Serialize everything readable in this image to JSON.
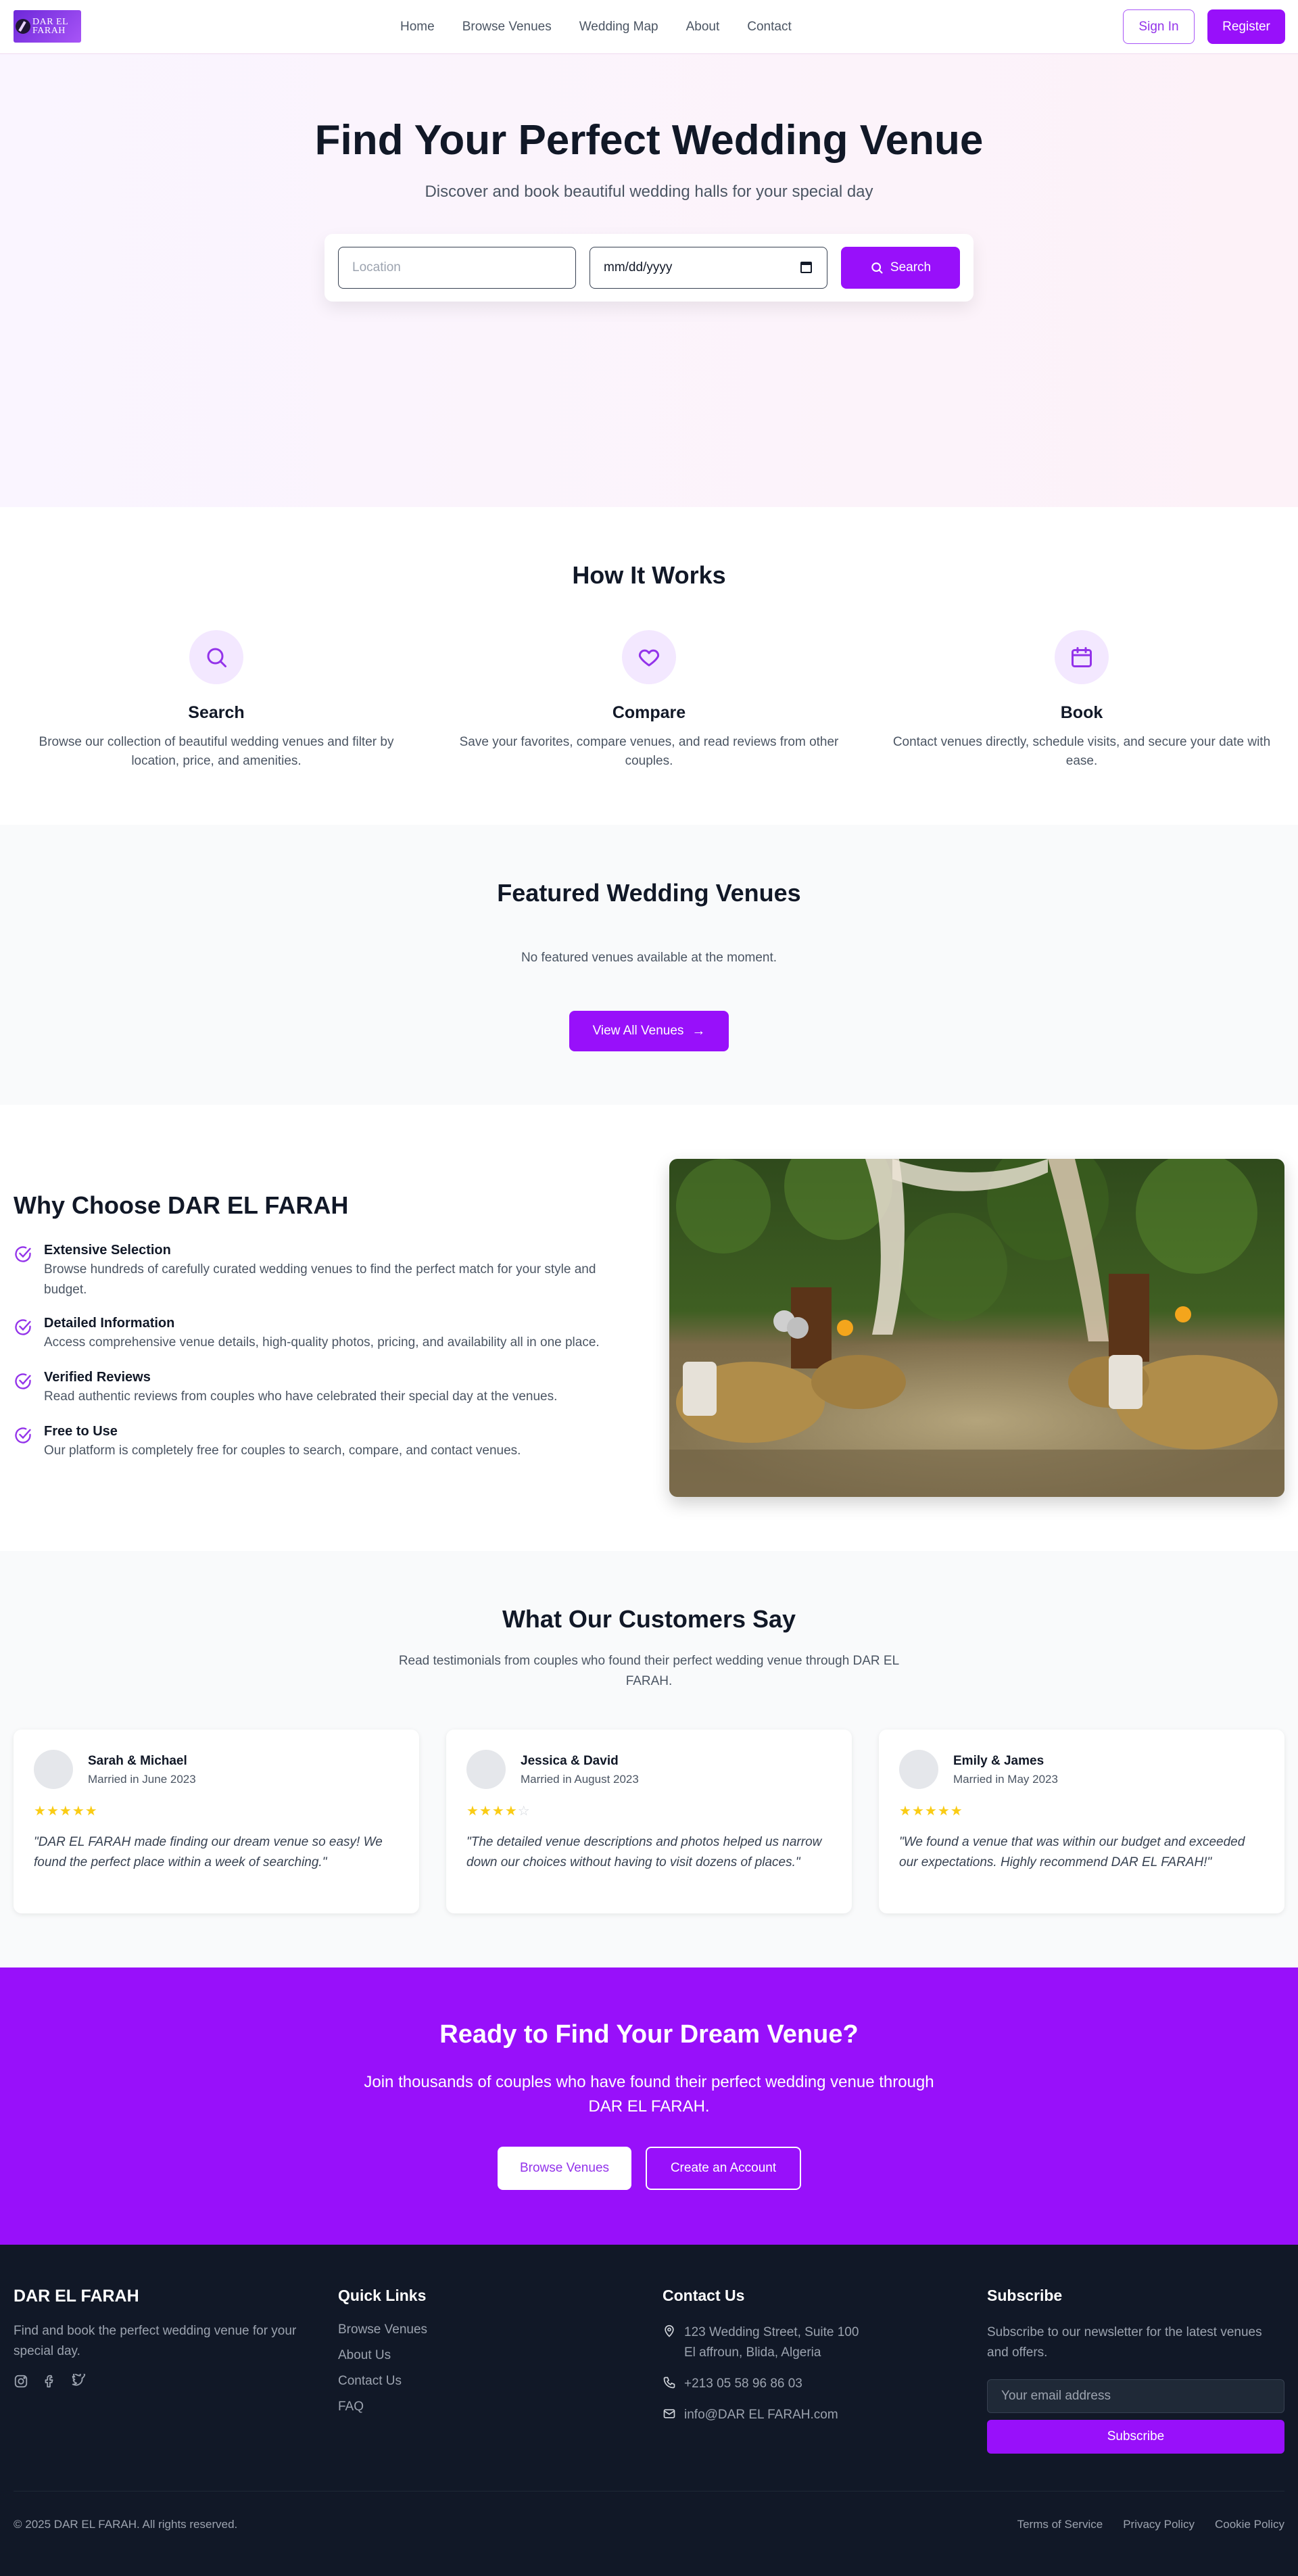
{
  "header": {
    "logo_text_line1": "DAR EL",
    "logo_text_line2": "FARAH",
    "nav": [
      "Home",
      "Browse Venues",
      "Wedding Map",
      "About",
      "Contact"
    ],
    "signin_label": "Sign In",
    "register_label": "Register"
  },
  "hero": {
    "title": "Find Your Perfect Wedding Venue",
    "subtitle": "Discover and book beautiful wedding halls for your special day",
    "location_placeholder": "Location",
    "date_value": "mm/dd/yyyy",
    "search_label": "Search"
  },
  "how": {
    "title": "How It Works",
    "steps": [
      {
        "icon": "search-icon",
        "title": "Search",
        "text": "Browse our collection of beautiful wedding venues and filter by location, price, and amenities."
      },
      {
        "icon": "heart-icon",
        "title": "Compare",
        "text": "Save your favorites, compare venues, and read reviews from other couples."
      },
      {
        "icon": "calendar-icon",
        "title": "Book",
        "text": "Contact venues directly, schedule visits, and secure your date with ease."
      }
    ]
  },
  "featured": {
    "title": "Featured Wedding Venues",
    "empty_text": "No featured venues available at the moment.",
    "view_all_label": "View All Venues"
  },
  "why": {
    "title": "Why Choose DAR EL FARAH",
    "features": [
      {
        "title": "Extensive Selection",
        "text": "Browse hundreds of carefully curated wedding venues to find the perfect match for your style and budget."
      },
      {
        "title": "Detailed Information",
        "text": "Access comprehensive venue details, high-quality photos, pricing, and availability all in one place."
      },
      {
        "title": "Verified Reviews",
        "text": "Read authentic reviews from couples who have celebrated their special day at the venues."
      },
      {
        "title": "Free to Use",
        "text": "Our platform is completely free for couples to search, compare, and contact venues."
      }
    ]
  },
  "testimonials": {
    "title": "What Our Customers Say",
    "subtitle": "Read testimonials from couples who found their perfect wedding venue through DAR EL FARAH.",
    "items": [
      {
        "name": "Sarah & Michael",
        "date": "Married in June 2023",
        "rating": 5,
        "quote": "\"DAR EL FARAH made finding our dream venue so easy! We found the perfect place within a week of searching.\""
      },
      {
        "name": "Jessica & David",
        "date": "Married in August 2023",
        "rating": 4,
        "quote": "\"The detailed venue descriptions and photos helped us narrow down our choices without having to visit dozens of places.\""
      },
      {
        "name": "Emily & James",
        "date": "Married in May 2023",
        "rating": 5,
        "quote": "\"We found a venue that was within our budget and exceeded our expectations. Highly recommend DAR EL FARAH!\""
      }
    ]
  },
  "cta": {
    "title": "Ready to Find Your Dream Venue?",
    "subtitle": "Join thousands of couples who have found their perfect wedding venue through DAR EL FARAH.",
    "browse_label": "Browse Venues",
    "create_label": "Create an Account"
  },
  "footer": {
    "brand": "DAR EL FARAH",
    "tagline": "Find and book the perfect wedding venue for your special day.",
    "quick_links_title": "Quick Links",
    "quick_links": [
      "Browse Venues",
      "About Us",
      "Contact Us",
      "FAQ"
    ],
    "contact_title": "Contact Us",
    "address_line1": "123 Wedding Street, Suite 100",
    "address_line2": "El affroun, Blida, Algeria",
    "phone": "+213 05 58 96 86 03",
    "email": "info@DAR EL FARAH.com",
    "subscribe_title": "Subscribe",
    "subscribe_text": "Subscribe to our newsletter for the latest venues and offers.",
    "email_placeholder": "Your email address",
    "subscribe_label": "Subscribe",
    "copyright": "© 2025 DAR EL FARAH. All rights reserved.",
    "legal": [
      "Terms of Service",
      "Privacy Policy",
      "Cookie Policy"
    ]
  },
  "colors": {
    "accent": "#9810fa",
    "footer_bg": "#111827",
    "star": "#facc15"
  }
}
